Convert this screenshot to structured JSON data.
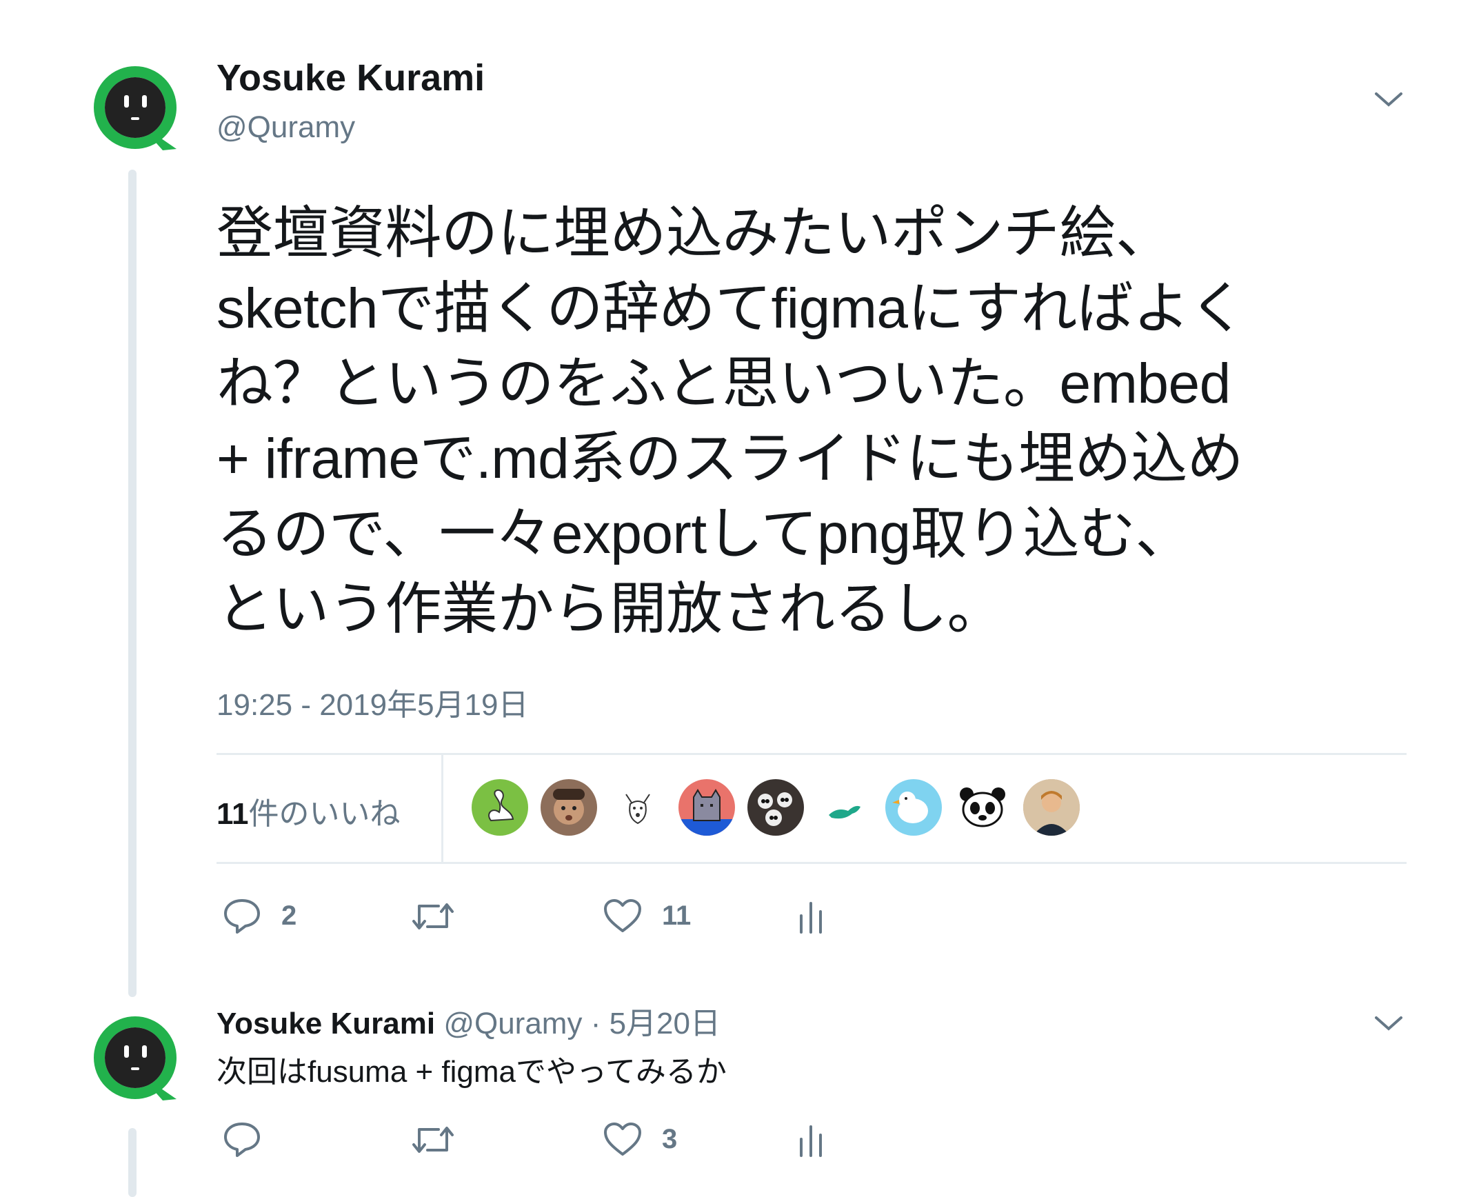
{
  "main_tweet": {
    "author_name": "Yosuke Kurami",
    "author_handle": "@Quramy",
    "text_lines": [
      "登壇資料のに埋め込みたいポンチ絵、",
      "sketchで描くの辞めてfigmaにすればよく",
      "ね？というのをふと思いついた。embed",
      "+ iframeで.md系のスライドにも埋め込め",
      "るので、一々exportしてpng取り込む、",
      "という作業から開放されるし。"
    ],
    "timestamp": "19:25 - 2019年5月19日",
    "likes_count_num": "11",
    "likes_label": "件のいいね",
    "replies": "2",
    "retweets": "",
    "likes": "11"
  },
  "likers": [
    {
      "icon": "swan-icon",
      "bg": "#7bc043"
    },
    {
      "icon": "man-face-icon",
      "bg": "#8d6e5a"
    },
    {
      "icon": "dog-sketch-icon",
      "bg": "#ffffff"
    },
    {
      "icon": "pixel-cat-icon",
      "bg": "#e9736b"
    },
    {
      "icon": "pandas-group-icon",
      "bg": "#3a3330"
    },
    {
      "icon": "green-otter-icon",
      "bg": "#ffffff"
    },
    {
      "icon": "white-bird-icon",
      "bg": "#7fd3f0"
    },
    {
      "icon": "panda-face-icon",
      "bg": "#ffffff"
    },
    {
      "icon": "person-photo-icon",
      "bg": "#c9a27a"
    }
  ],
  "reply_tweet": {
    "author_name": "Yosuke Kurami",
    "author_handle": "@Quramy",
    "separator": "·",
    "date": "5月20日",
    "text": "次回はfusuma + figmaでやってみるか",
    "replies": "",
    "retweets": "",
    "likes": "3"
  },
  "colors": {
    "avatar_ring": "#22b24c",
    "avatar_face": "#222222",
    "muted": "#657786",
    "divider": "#e6ecf0"
  }
}
